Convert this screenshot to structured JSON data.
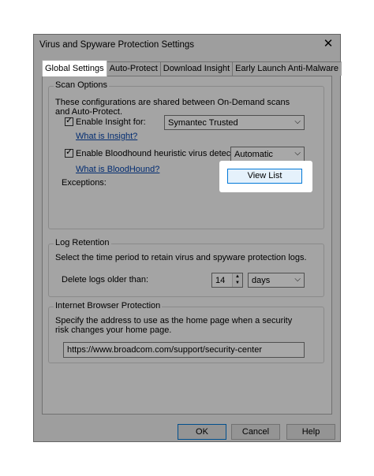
{
  "dialog": {
    "title": "Virus and Spyware Protection Settings",
    "close_glyph": "✕"
  },
  "tabs": [
    {
      "label": "Global Settings",
      "active": true
    },
    {
      "label": "Auto-Protect"
    },
    {
      "label": "Download Insight"
    },
    {
      "label": "Early Launch Anti-Malware"
    }
  ],
  "scan_options": {
    "heading": "Scan Options",
    "description": "These configurations are shared between On-Demand scans and Auto-Protect.",
    "insight_checkbox_label": "Enable Insight for:",
    "insight_checked": true,
    "insight_select_value": "Symantec Trusted",
    "insight_link": "What is Insight?",
    "bloodhound_checkbox_label": "Enable Bloodhound heuristic virus detection",
    "bloodhound_checked": true,
    "bloodhound_select_value": "Automatic",
    "bloodhound_link": "What is BloodHound?",
    "exceptions_label": "Exceptions:",
    "view_list_button": "View List"
  },
  "log_retention": {
    "heading": "Log Retention",
    "description": "Select the time period to retain virus and spyware protection logs.",
    "delete_label": "Delete logs older than:",
    "days_value": "14",
    "unit_value": "days"
  },
  "browser_protection": {
    "heading": "Internet Browser Protection",
    "description": "Specify the address to use as the home page when a security risk changes your home page.",
    "home_page_url": "https://www.broadcom.com/support/security-center"
  },
  "footer": {
    "ok": "OK",
    "cancel": "Cancel",
    "help": "Help"
  },
  "glyphs": {
    "check": "✓",
    "dropdown": "⌵",
    "spin_up": "▲",
    "spin_down": "▼"
  }
}
